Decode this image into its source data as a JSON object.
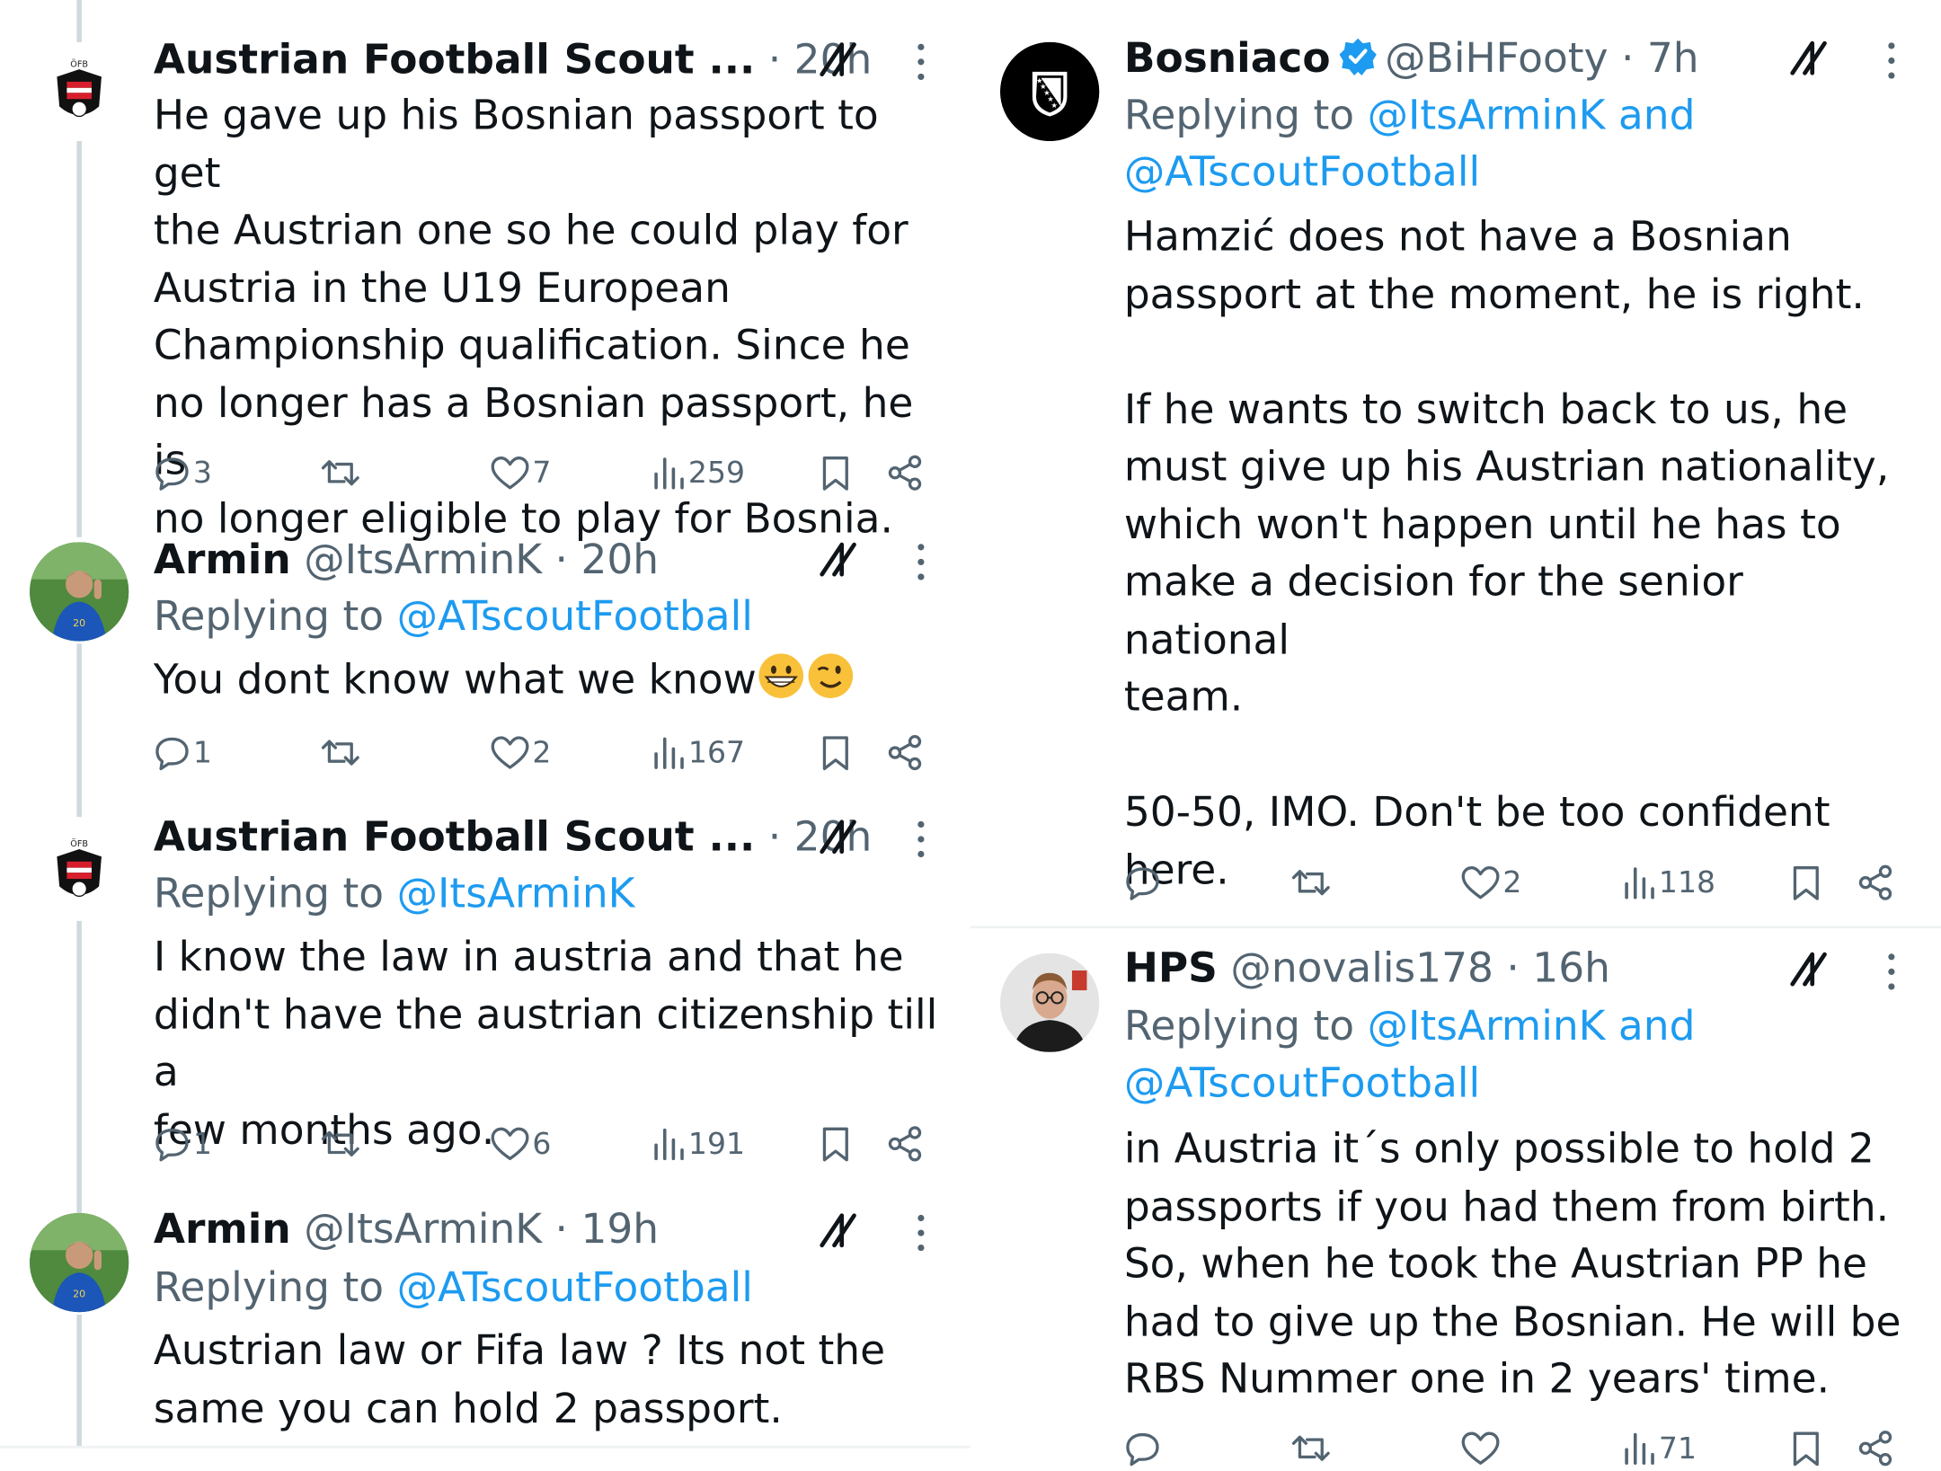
{
  "left": {
    "tweets": [
      {
        "name": "Austrian Football Scout ...",
        "meta": "· 20h",
        "avatar_icon": "oefb-crest-icon",
        "body": [
          "He gave up his Bosnian passport to get",
          "the Austrian one so he could play for",
          "Austria in the U19 European",
          "Championship qualification. Since he",
          "no longer has a Bosnian passport, he is",
          "no longer eligible to play for Bosnia."
        ],
        "replies": "3",
        "retweets": "",
        "likes": "7",
        "views": "259"
      },
      {
        "name": "Armin",
        "meta": "@ItsArminK · 20h",
        "avatar_icon": "player-photo-avatar",
        "replying_prefix": "Replying to ",
        "replying_links": "@ATscoutFootball",
        "body_text": "You dont know what we know",
        "emojis": [
          "grinning-face-emoji",
          "winking-face-emoji"
        ],
        "replies": "1",
        "retweets": "",
        "likes": "2",
        "views": "167"
      },
      {
        "name": "Austrian Football Scout ...",
        "meta": "· 20h",
        "avatar_icon": "oefb-crest-icon",
        "replying_prefix": "Replying to ",
        "replying_links": "@ItsArminK",
        "body": [
          "I know the law in austria and that he",
          "didn't have the austrian citizenship till a",
          "few months ago."
        ],
        "replies": "1",
        "retweets": "",
        "likes": "6",
        "views": "191"
      },
      {
        "name": "Armin",
        "meta": "@ItsArminK · 19h",
        "avatar_icon": "player-photo-avatar",
        "replying_prefix": "Replying to ",
        "replying_links": "@ATscoutFootball",
        "body": [
          "Austrian law or Fifa law ? Its not the",
          "same you can hold 2 passport."
        ]
      }
    ]
  },
  "right": {
    "tweets": [
      {
        "name": "Bosniaco",
        "meta": "@BiHFooty · 7h",
        "verified": true,
        "avatar_icon": "bosnia-shield-icon",
        "replying_prefix": "Replying to ",
        "replying_links_line1": "@ItsArminK and",
        "replying_links_line2": "@ATscoutFootball",
        "para1": [
          "Hamzić does not have a Bosnian",
          "passport at the moment, he is right."
        ],
        "para2": [
          "If he wants to switch back to us, he",
          "must give up his Austrian nationality,",
          "which won't happen until he has to",
          "make a decision for the senior national",
          "team."
        ],
        "para3": [
          "50-50, IMO. Don't be too confident",
          "here."
        ],
        "replies": "",
        "retweets": "",
        "likes": "2",
        "views": "118"
      },
      {
        "name": "HPS",
        "meta": "@novalis178 · 16h",
        "avatar_icon": "man-with-glasses-avatar",
        "replying_prefix": "Replying to ",
        "replying_links_line1": "@ItsArminK and",
        "replying_links_line2": "@ATscoutFootball",
        "body": [
          "in Austria it´s only possible to hold 2",
          "passports if you had them from birth.",
          "So, when he took the Austrian PP he",
          "had to give up the Bosnian. He will be",
          "RBS Nummer one in 2 years' time."
        ],
        "replies": "",
        "retweets": "",
        "likes": "",
        "views": "71"
      }
    ]
  },
  "colors": {
    "link": "#1d9bf0",
    "meta": "#536471",
    "text": "#0f1419",
    "verified": "#1d9bf0"
  }
}
